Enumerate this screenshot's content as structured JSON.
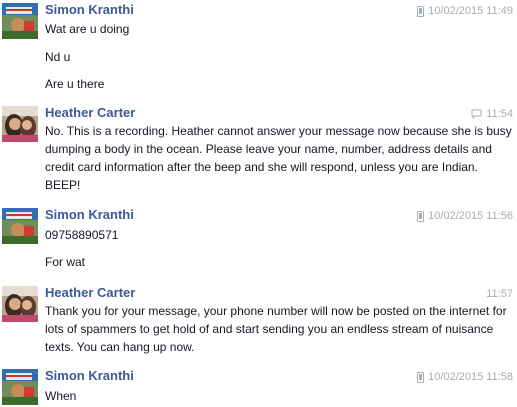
{
  "messages": [
    {
      "author": "Simon Kranthi",
      "source_icon": "mobile-phone-icon",
      "timestamp": "10/02/2015 11:49",
      "lines": [
        "Wat are u doing",
        "Nd u",
        "Are u there"
      ]
    },
    {
      "author": "Heather Carter",
      "source_icon": "chat-bubble-icon",
      "timestamp": "11:54",
      "text": "No. This is a recording. Heather cannot answer your message now because she is busy dumping a body in the ocean. Please leave your name, number, address details and credit card information after the beep and she will respond, unless you are Indian. BEEP!"
    },
    {
      "author": "Simon Kranthi",
      "source_icon": "mobile-phone-icon",
      "timestamp": "10/02/2015 11:56",
      "lines": [
        "09758890571",
        "For wat"
      ]
    },
    {
      "author": "Heather Carter",
      "timestamp": "11:57",
      "text": "Thank you for your message, your phone number will now be posted on the internet for lots of spammers to get hold of and start sending you an endless stream of nuisance texts. You can hang up now."
    },
    {
      "author": "Simon Kranthi",
      "source_icon": "mobile-phone-icon",
      "timestamp": "10/02/2015 11:58",
      "lines": [
        "When"
      ]
    }
  ],
  "colors": {
    "author_name": "#3b5998",
    "message_text": "#141823",
    "timestamp": "#a7adb5"
  }
}
